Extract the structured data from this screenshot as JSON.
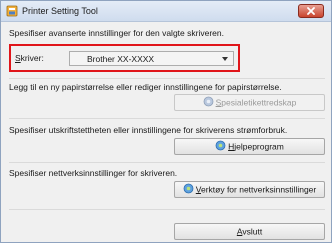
{
  "window": {
    "title": "Printer Setting Tool",
    "close_label": "close"
  },
  "intro": {
    "text": "Spesifiser avanserte innstillinger for den valgte skriveren."
  },
  "printer": {
    "label_accel": "S",
    "label_rest": "kriver:",
    "selected": "Brother XX-XXXX"
  },
  "paper": {
    "text": "Legg til en ny papirstørrelse eller rediger innstillingene for papirstørrelse.",
    "button_accel": "S",
    "button_rest": "pesialetikettredskap"
  },
  "utility": {
    "text": "Spesifiser utskriftstettheten eller innstillingene for skriverens strømforbruk.",
    "button_accel": "H",
    "button_rest": "jelpeprogram"
  },
  "network": {
    "text": "Spesifiser nettverksinnstillinger for skriveren.",
    "button_accel": "V",
    "button_rest": "erktøy for nettverksinnstillinger"
  },
  "exit": {
    "button_accel": "A",
    "button_rest": "vslutt"
  },
  "colors": {
    "highlight": "#e0151a",
    "close": "#c9442e"
  },
  "icons": {
    "app": "printer-settings-icon",
    "button": "shield-gear-icon"
  }
}
